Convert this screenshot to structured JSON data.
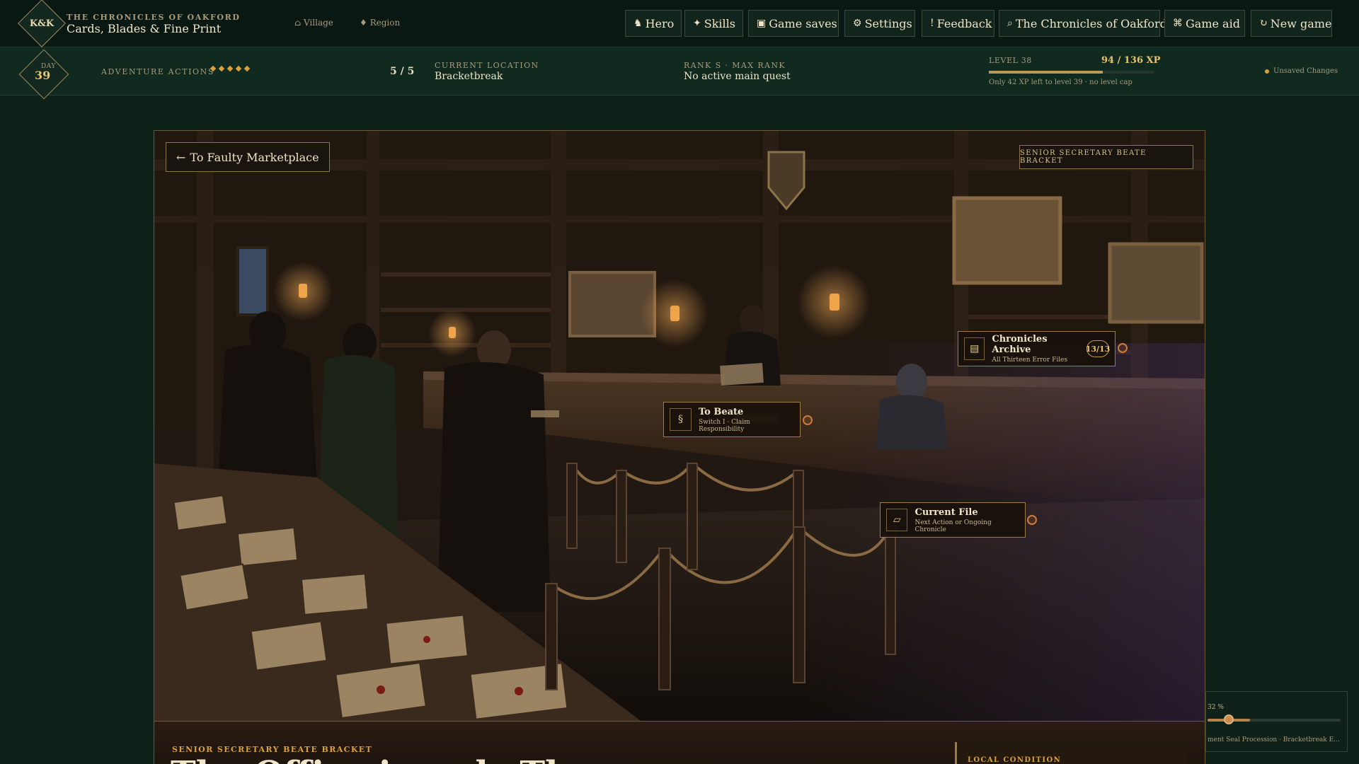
{
  "brand": {
    "logo": "K&K",
    "subtitle": "THE CHRONICLES OF OAKFORD",
    "title": "Cards, Blades & Fine Print"
  },
  "nav": {
    "village": "⌂ Village",
    "region": "♦ Region"
  },
  "toolbar": [
    {
      "icon": "♞",
      "label": "Hero",
      "icon_name": "hero-icon"
    },
    {
      "icon": "✦",
      "label": "Skills",
      "icon_name": "skills-icon"
    },
    {
      "icon": "▣",
      "label": "Game saves",
      "icon_name": "save-icon"
    },
    {
      "icon": "⚙",
      "label": "Settings",
      "icon_name": "gear-icon"
    },
    {
      "icon": "!",
      "label": "Feedback",
      "icon_name": "feedback-icon"
    },
    {
      "icon": "⌕",
      "label": "The Chronicles of Oakford",
      "icon_name": "chronicles-icon"
    },
    {
      "icon": "⌘",
      "label": "Game aid",
      "icon_name": "game-aid-icon"
    },
    {
      "icon": "↻",
      "label": "New game",
      "icon_name": "new-game-icon"
    }
  ],
  "status": {
    "day_label": "DAY",
    "day": "39",
    "adventure_label": "ADVENTURE ACTIONS",
    "adventure_pips": 5,
    "adventure_count": "5 / 5",
    "location_label": "CURRENT LOCATION",
    "location": "Bracketbreak",
    "rank_label": "RANK S · MAX RANK",
    "quest": "No active main quest",
    "level_label": "LEVEL 38",
    "xp": "94 / 136 XP",
    "xp_progress": 0.69,
    "xp_note": "Only 42 XP left to level 39 · no level cap",
    "unsaved": "Unsaved Changes"
  },
  "scene": {
    "back_button": "To Faulty Marketplace",
    "npc_tag": "SENIOR SECRETARY BEATE BRACKET",
    "hotspots": [
      {
        "icon": "▤",
        "title": "Chronicles Archive",
        "sub": "All Thirteen Error Files",
        "count": "13/13"
      },
      {
        "icon": "§",
        "title": "To Beate",
        "sub": "Switch I · Claim Responsibility"
      },
      {
        "icon": "▱",
        "title": "Current File",
        "sub": "Next Action or Ongoing Chronicle"
      }
    ]
  },
  "panel": {
    "kicker": "SENIOR SECRETARY BEATE BRACKET",
    "title": "The Office in only The",
    "local_condition": "LOCAL CONDITION"
  },
  "progress": {
    "percent_label": "32 %",
    "value": 0.32,
    "caption": "ment Seal Procession · Bracketbreak Error Ch..."
  },
  "colors": {
    "background": "#0d2119",
    "accent": "#d9a13a",
    "border": "#9d7b43"
  }
}
